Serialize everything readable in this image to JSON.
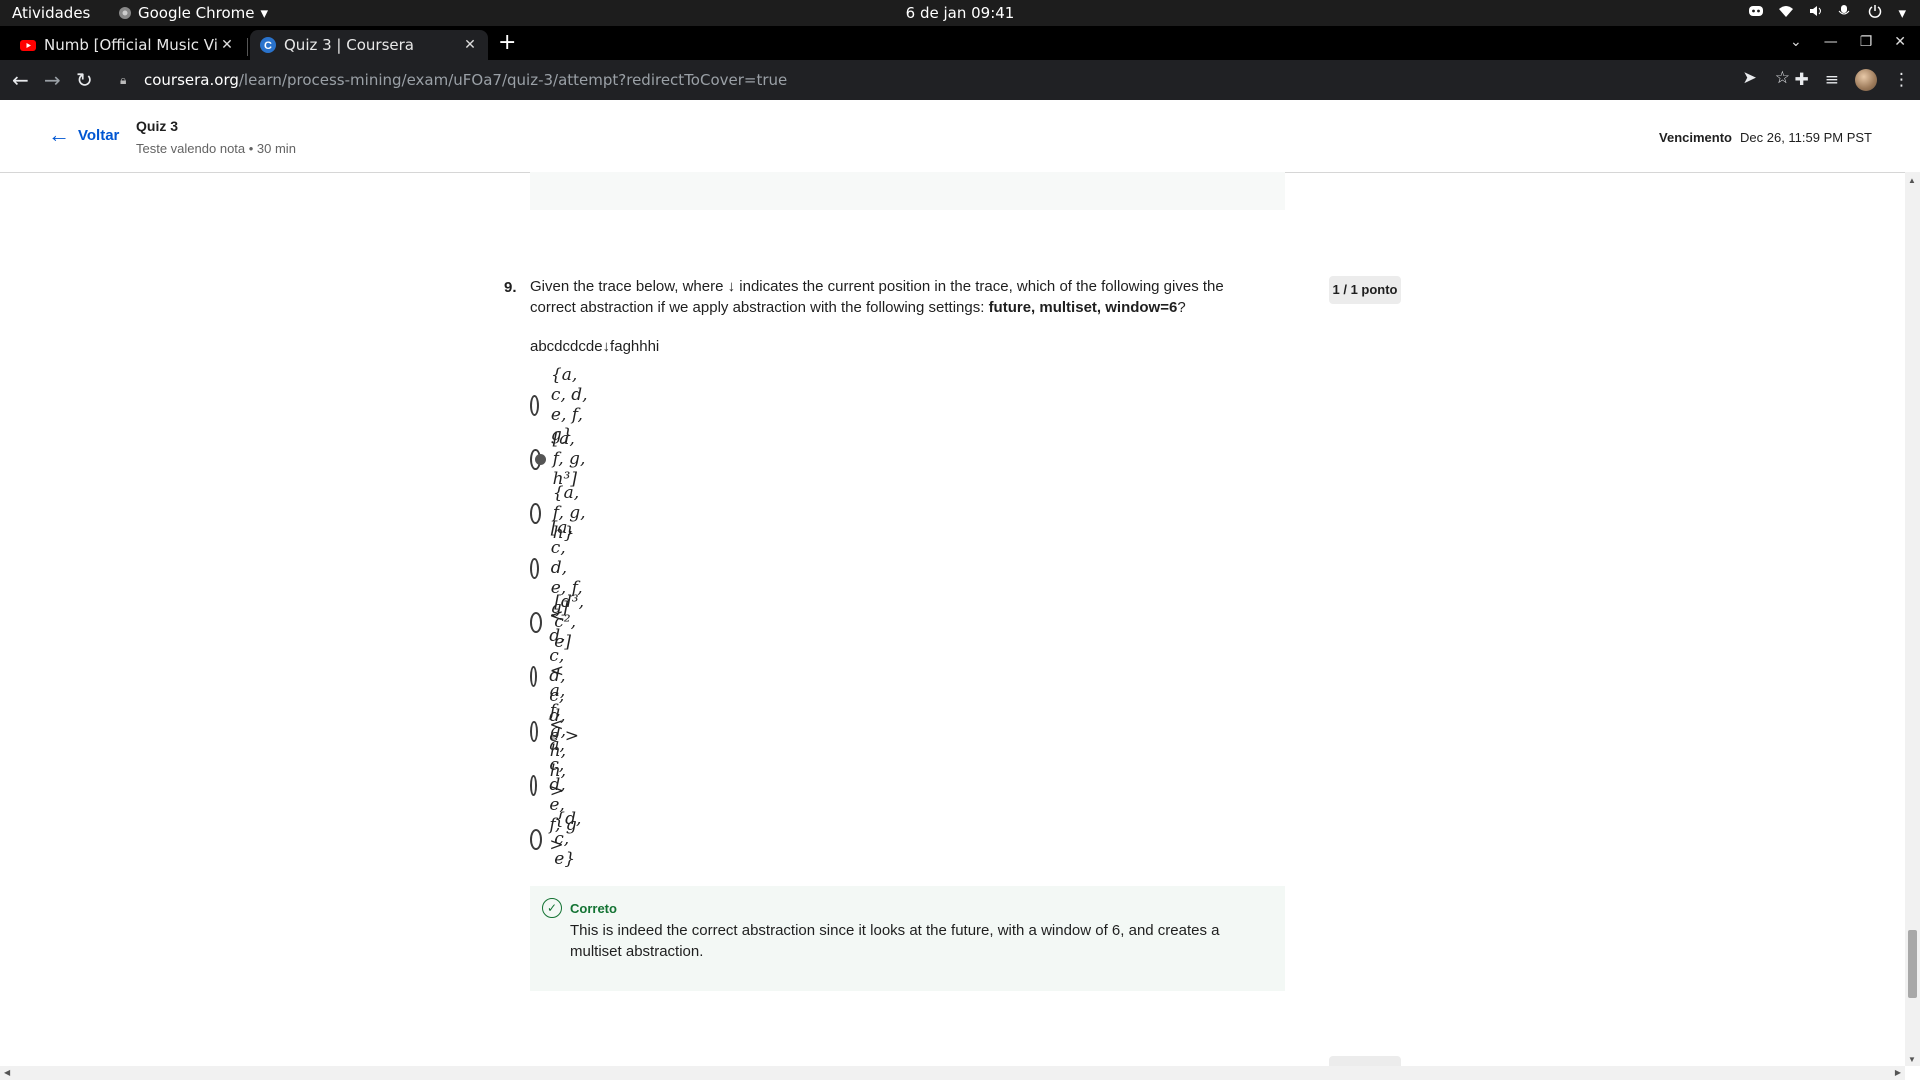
{
  "os": {
    "activities": "Atividades",
    "app_name": "Google Chrome",
    "clock": "6 de jan  09:41"
  },
  "browser": {
    "tabs": [
      {
        "title": "Numb [Official Music Video]",
        "favicon": "youtube-icon"
      },
      {
        "title": "Quiz 3 | Coursera",
        "favicon": "coursera-icon",
        "active": true
      }
    ],
    "url_host": "coursera.org",
    "url_path": "/learn/process-mining/exam/uFOa7/quiz-3/attempt?redirectToCover=true"
  },
  "header": {
    "back_label": "Voltar",
    "quiz_title": "Quiz 3",
    "quiz_subtitle": "Teste valendo nota • 30 min",
    "due_label": "Vencimento",
    "due_value": "Dec 26, 11:59 PM PST"
  },
  "question": {
    "number": "9.",
    "text_before": "Given the trace below, where ↓ indicates the current position in the trace, which of the following gives the correct abstraction if we apply abstraction with the following settings: ",
    "text_bold": "future, multiset, window=6",
    "text_after": "?",
    "points": "1 / 1 ponto",
    "trace": "abcdcdcde↓faghhhi",
    "options": [
      {
        "label": "{a, c, d, e, f, g}",
        "selected": false
      },
      {
        "label": "[a, f, g, h³]",
        "selected": true
      },
      {
        "label": "{a, f, g, h}",
        "selected": false
      },
      {
        "label": "[a, c, d, e, f, g]",
        "selected": false
      },
      {
        "label": "[d³, c², e]",
        "selected": false
      },
      {
        "label": "< d, c, d, c, d, e >",
        "selected": false
      },
      {
        "label": "< a, f, g, h, h, >",
        "selected": false
      },
      {
        "label": "< a, c, d, e, f, g >",
        "selected": false
      },
      {
        "label": "{d, c, e}",
        "selected": false
      }
    ]
  },
  "feedback": {
    "status": "Correto",
    "text": "This is indeed the correct abstraction since it looks at the future, with a window of 6, and creates a multiset abstraction."
  },
  "colors": {
    "link_blue": "#0056d2",
    "correct_green": "#137333",
    "feedback_bg": "#f3f8f5"
  }
}
